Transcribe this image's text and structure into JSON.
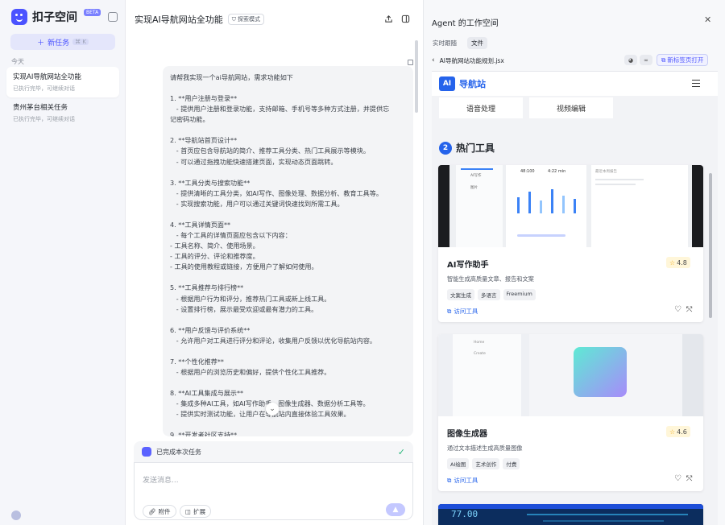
{
  "sidebar": {
    "logo_text": "扣子空间",
    "beta_badge": "BETA",
    "new_task_label": "新任务",
    "new_task_shortcut": "⌘ K",
    "section_today": "今天",
    "history": [
      {
        "title": "实现AI导航网站全功能",
        "subtitle": "已执行完毕，可继续对话"
      },
      {
        "title": "贵州茅台相关任务",
        "subtitle": "已执行完毕，可继续对话"
      }
    ]
  },
  "chat": {
    "title": "实现AI导航网站全功能",
    "mode_badge": "探索模式",
    "message_lines": [
      "请帮我实现一个ai导航网站，需求功能如下",
      "",
      "1. **用户注册与登录**",
      "   - 提供用户注册和登录功能，支持邮箱、手机号等多种方式注册，并提供忘",
      "记密码功能。",
      "",
      "2. **导航站首页设计**",
      "   - 首页应包含导航站的简介、推荐工具分类、热门工具展示等模块。",
      "   - 可以通过拖拽功能快速搭建页面，实现动态页面跳转。",
      "",
      "3. **工具分类与搜索功能**",
      "   - 提供清晰的工具分类，如AI写作、图像处理、数据分析、教育工具等。",
      "   - 实现搜索功能，用户可以通过关键词快速找到所需工具。",
      "",
      "4. **工具详情页面**",
      "   - 每个工具的详情页面应包含以下内容：",
      "- 工具名称、简介、使用场景。",
      "- 工具的评分、评论和推荐度。",
      "- 工具的使用教程或链接，方便用户了解如何使用。",
      "",
      "5. **工具推荐与排行榜**",
      "   - 根据用户行为和评分，推荐热门工具或新上线工具。",
      "   - 设置排行榜，展示最受欢迎或最有潜力的工具。",
      "",
      "6. **用户反馈与评价系统**",
      "   - 允许用户对工具进行评分和评论，收集用户反馈以优化导航站内容。",
      "",
      "7. **个性化推荐**",
      "   - 根据用户的浏览历史和偏好，提供个性化工具推荐。",
      "",
      "8. **AI工具集成与展示**",
      "   - 集成多种AI工具，如AI写作助手、图像生成器、数据分析工具等。",
      "   - 提供实时测试功能，让用户在导航站内直接体验工具效果。",
      "",
      "9. **开发者社区支持**"
    ],
    "status_text": "已完成本次任务",
    "composer_placeholder": "发送消息...",
    "attach_label": "附件",
    "extend_label": "扩展"
  },
  "agent": {
    "title": "Agent 的工作空间",
    "tabs": [
      "实时跟随",
      "文件"
    ],
    "file_name": "AI导航网站功能规划.jsx",
    "open_new_tab": "新标签页打开",
    "preview": {
      "brand_logo": "AI",
      "brand_name": "导航站",
      "categories": [
        "语音处理",
        "视频编辑"
      ],
      "section_num": "2",
      "section_title": "热门工具",
      "tools": [
        {
          "name": "AI写作助手",
          "rating": "4.8",
          "desc": "智能生成高质量文章、报告和文案",
          "tags": [
            "文案生成",
            "多语言",
            "Freemium"
          ],
          "visit": "访问工具"
        },
        {
          "name": "图像生成器",
          "rating": "4.6",
          "desc": "通过文本描述生成高质量图像",
          "tags": [
            "AI绘图",
            "艺术创作",
            "付费"
          ],
          "visit": "访问工具"
        }
      ],
      "mock_screen": {
        "a": "AI写作",
        "b": "图片",
        "c": "48:100",
        "d": "4:22 min",
        "e": "最近本周报告"
      },
      "mock_screen2": {
        "a": "Home",
        "b": "Create"
      },
      "third_image_text": "77.00"
    }
  }
}
